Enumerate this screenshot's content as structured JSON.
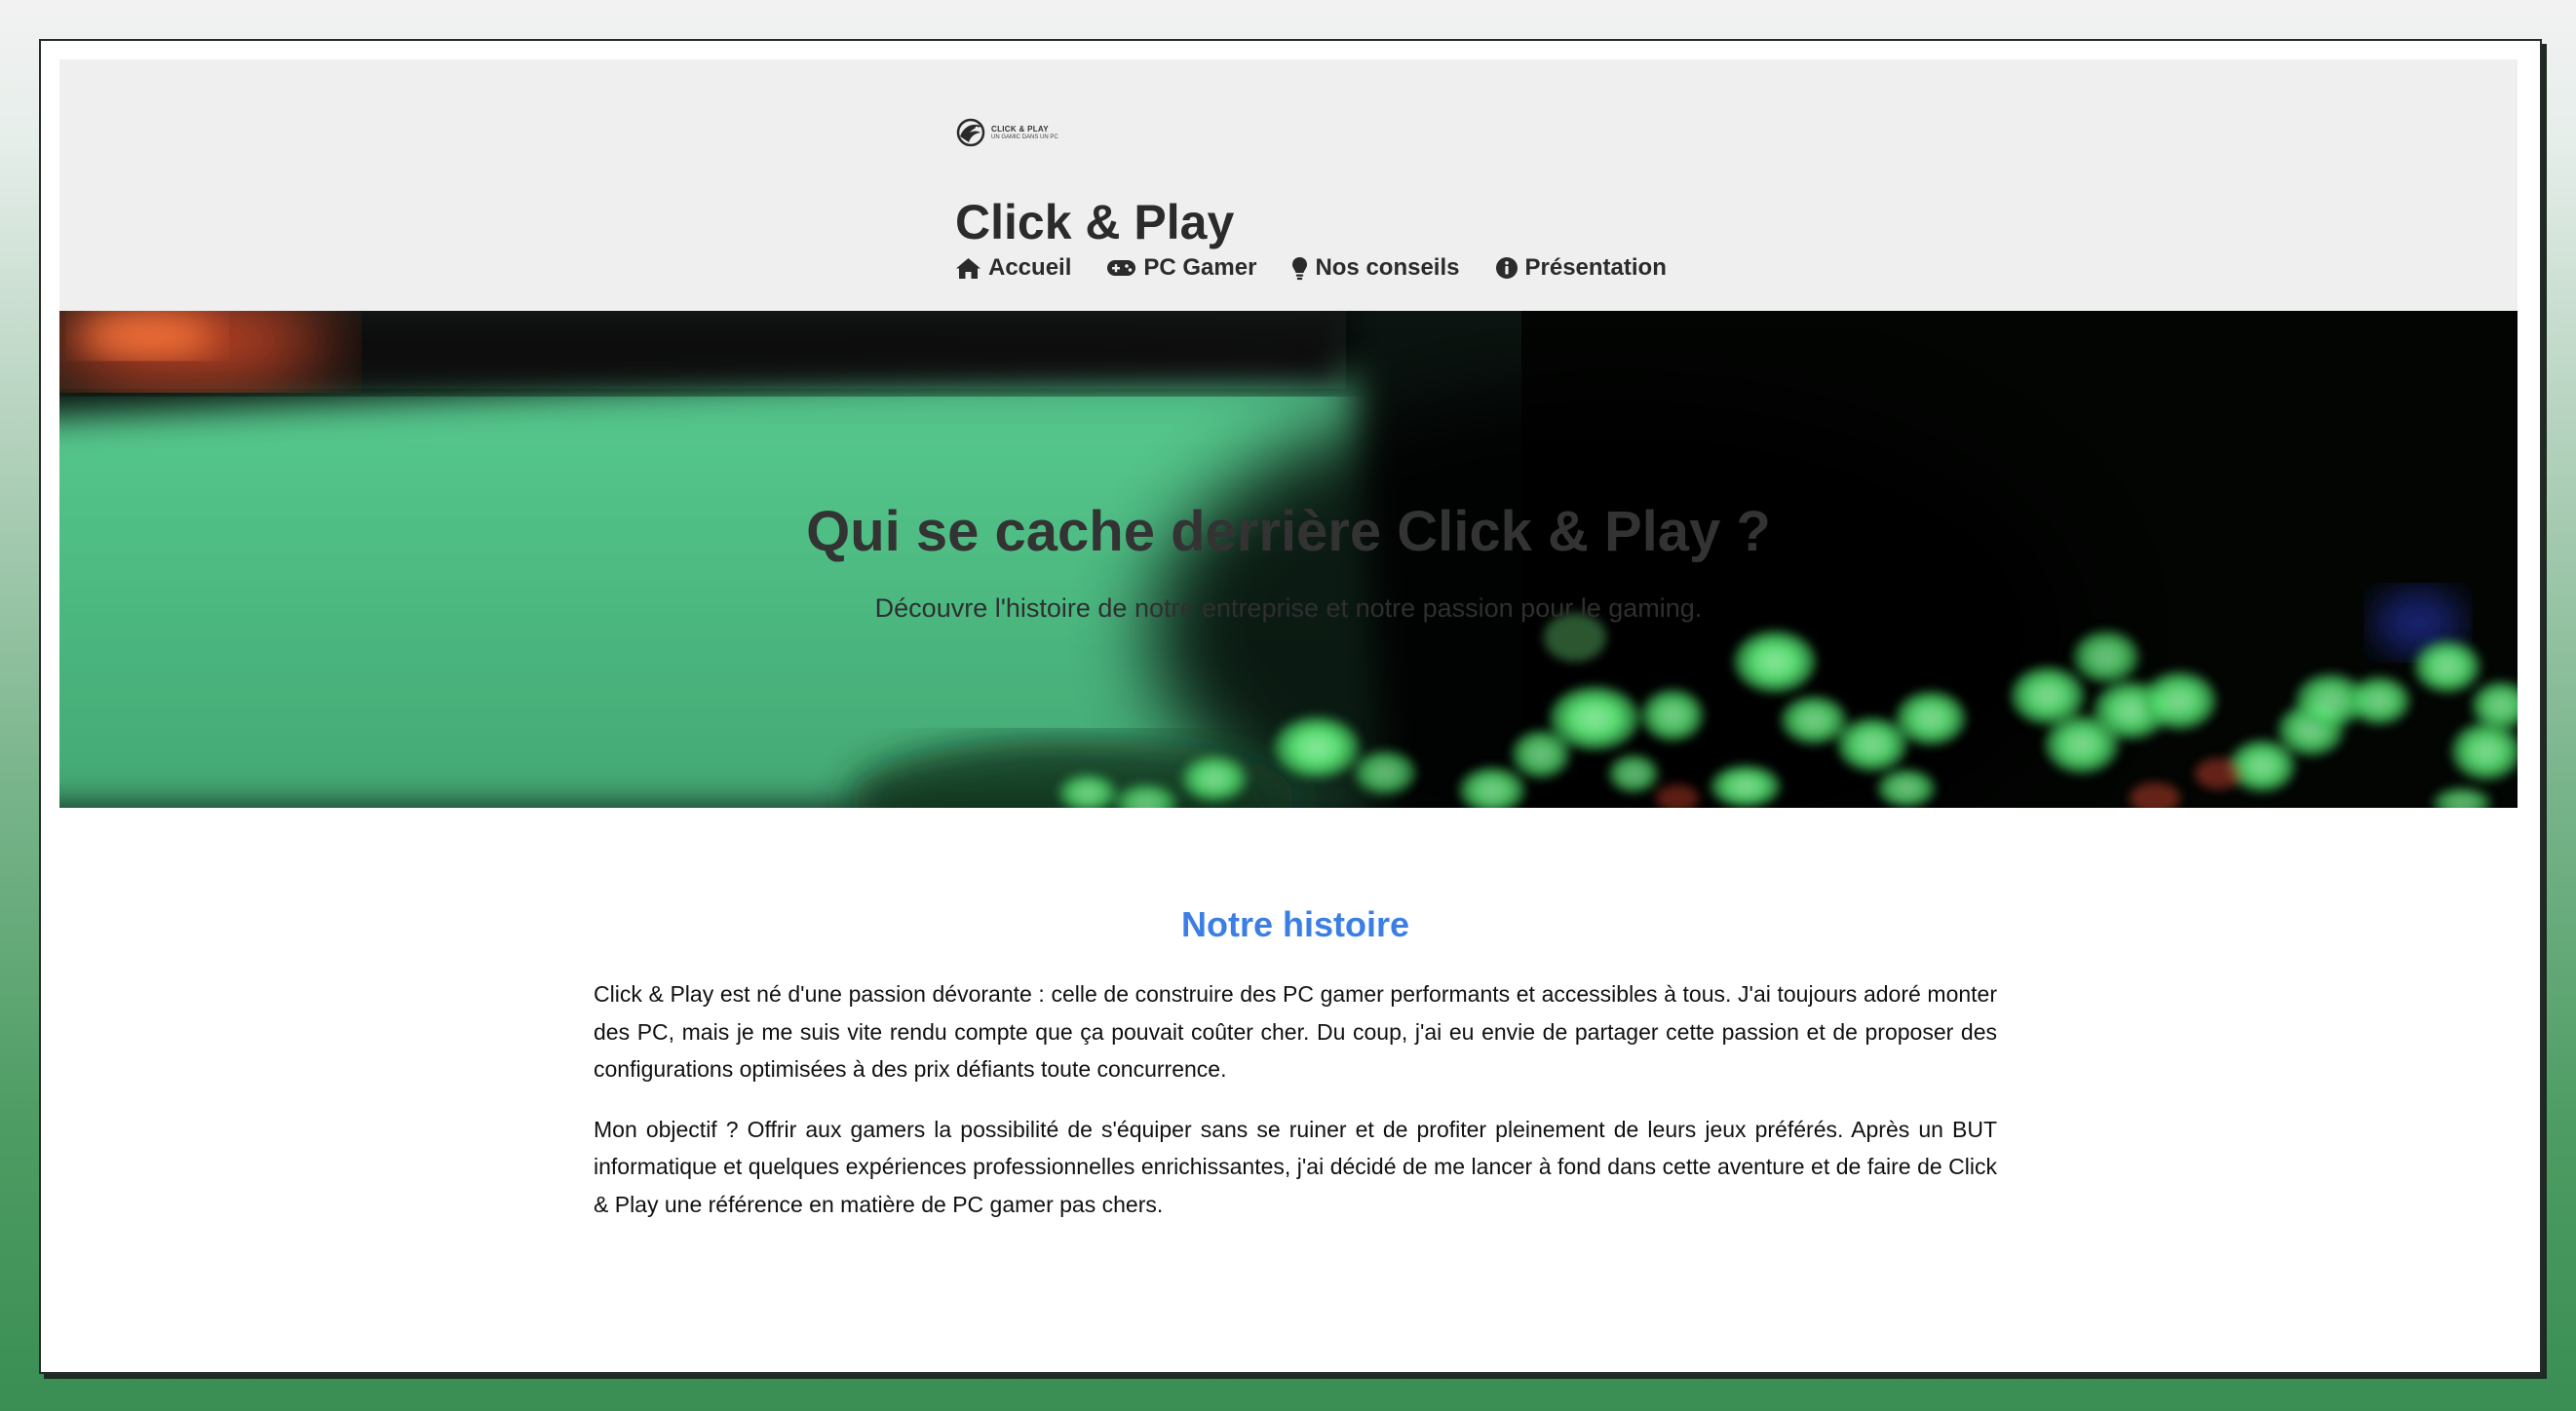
{
  "logo": {
    "name": "CLICK & PLAY",
    "tagline": "UN GAMIC DANS UN PC"
  },
  "header": {
    "title": "Click & Play"
  },
  "nav": {
    "items": [
      {
        "label": "Accueil",
        "icon": "home-icon"
      },
      {
        "label": "PC Gamer",
        "icon": "gamepad-icon"
      },
      {
        "label": "Nos conseils",
        "icon": "lightbulb-icon"
      },
      {
        "label": "Présentation",
        "icon": "info-circle-icon"
      }
    ]
  },
  "hero": {
    "title": "Qui se cache derrière Click & Play ?",
    "subtitle": "Découvre l'histoire de notre entreprise et notre passion pour le gaming."
  },
  "main": {
    "section_title": "Notre histoire",
    "paragraphs": [
      "Click & Play est né d'une passion dévorante : celle de construire des PC gamer performants et accessibles à tous. J'ai toujours adoré monter des PC, mais je me suis vite rendu compte que ça pouvait coûter cher. Du coup, j'ai eu envie de partager cette passion et de proposer des configurations optimisées à des prix défiants toute concurrence.",
      "Mon objectif ? Offrir aux gamers la possibilité de s'équiper sans se ruiner et de profiter pleinement de leurs jeux préférés. Après un BUT informatique et quelques expériences professionnelles enrichissantes, j'ai décidé de me lancer à fond dans cette aventure et de faire de Click & Play une référence en matière de PC gamer pas chers."
    ]
  },
  "colors": {
    "accent": "#3b7fe4",
    "header_bg": "#efefef",
    "hero_green": "#55c78c",
    "bokeh_green": "#5ef27a"
  }
}
